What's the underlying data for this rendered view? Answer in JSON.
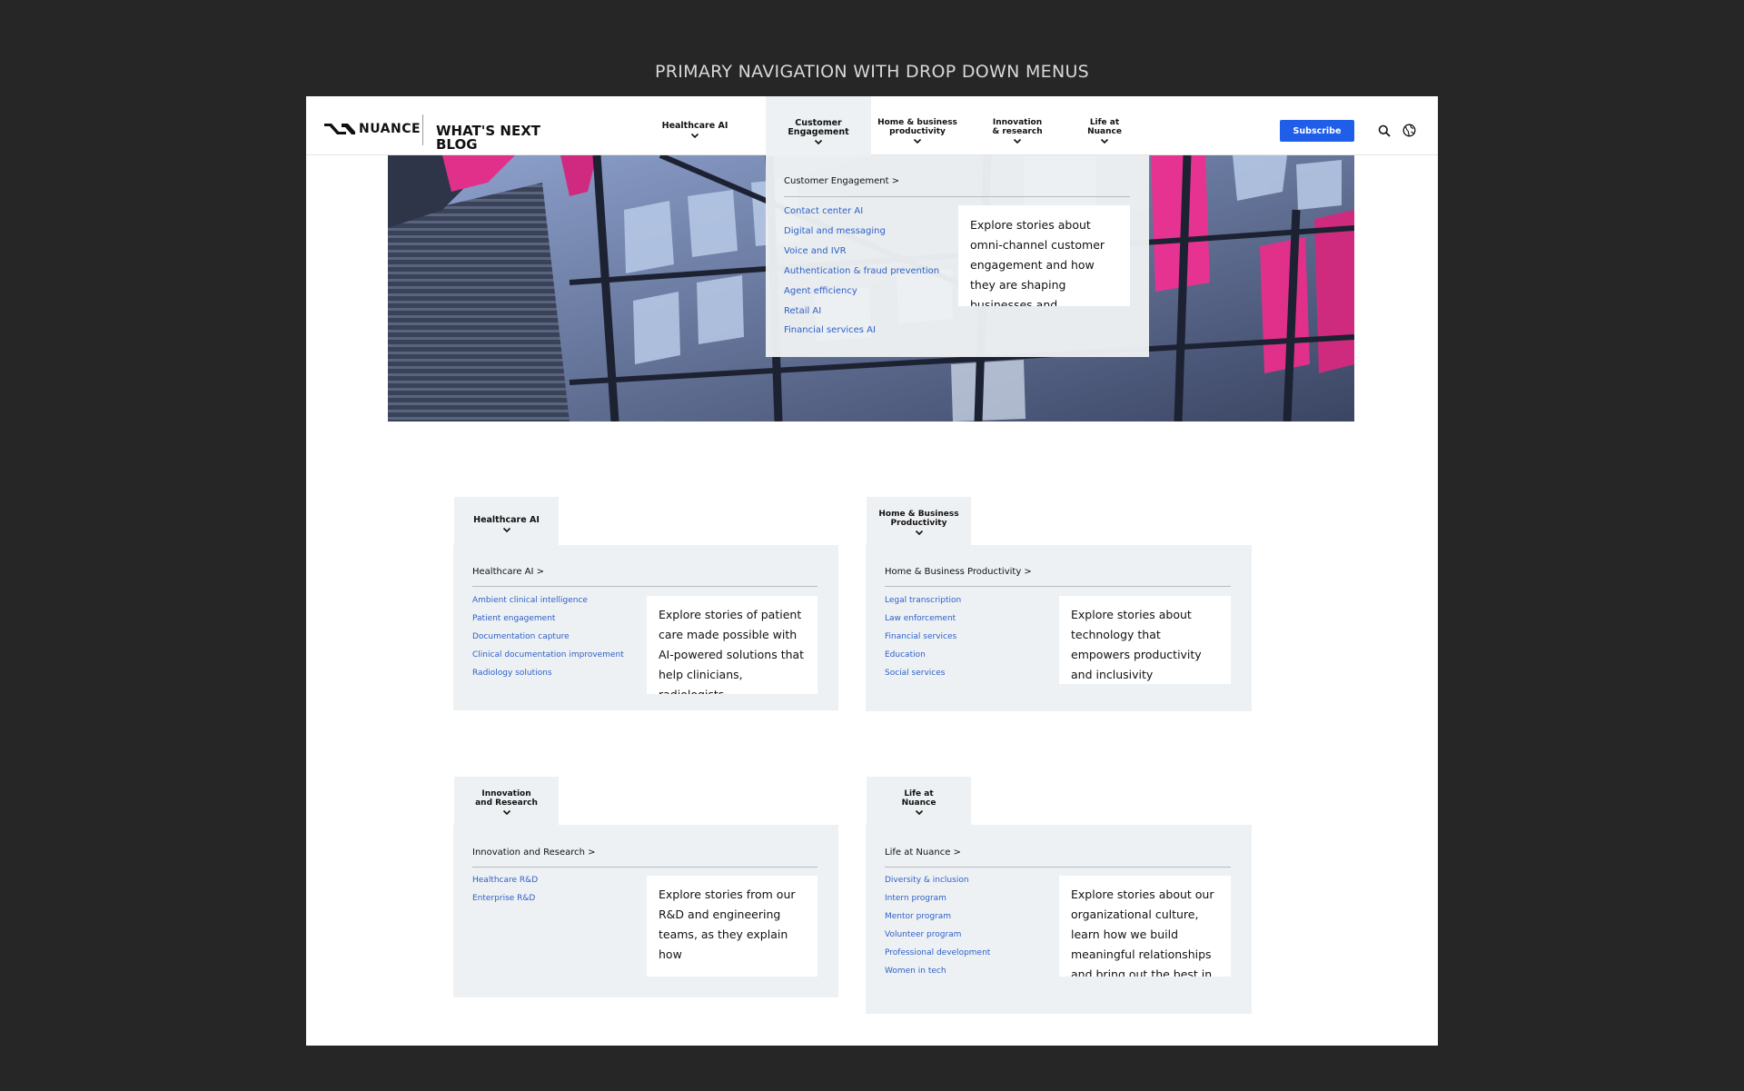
{
  "caption": "PRIMARY NAVIGATION WITH DROP DOWN MENUS",
  "header": {
    "logo_text": "NUANCE",
    "blog_title": "WHAT'S NEXT BLOG",
    "nav": [
      {
        "label": "Healthcare AI"
      },
      {
        "label": "Customer\nEngagement"
      },
      {
        "label": "Home & business\nproductivity"
      },
      {
        "label": "Innovation\n& research"
      },
      {
        "label": "Life at\nNuance"
      }
    ],
    "subscribe_label": "Subscribe",
    "icons": {
      "search": "search-icon",
      "globe": "globe-icon",
      "chevron": "chevron-down-icon"
    }
  },
  "dropdown": {
    "heading": "Customer Engagement >",
    "links": [
      "Contact center AI",
      "Digital and messaging",
      "Voice and IVR",
      "Authentication & fraud prevention",
      "Agent efficiency",
      "Retail AI",
      "Financial services AI"
    ],
    "card_text": "Explore stories about omni-channel customer engagement and how they are shaping businesses and"
  },
  "variants": [
    {
      "tab_label": "Healthcare AI",
      "heading": "Healthcare AI >",
      "links": [
        "Ambient clinical intelligence",
        "Patient engagement",
        "Documentation capture",
        "Clinical documentation improvement",
        "Radiology solutions"
      ],
      "card_text": "Explore stories of patient care made possible with AI-powered solutions that help clinicians, radiologists,"
    },
    {
      "tab_label": "Home & Business\nProductivity",
      "heading": "Home & Business Productivity >",
      "links": [
        "Legal transcription",
        "Law enforcement",
        "Financial services",
        "Education",
        "Social services"
      ],
      "card_text": "Explore stories about technology that empowers productivity and inclusivity"
    },
    {
      "tab_label": "Innovation\nand Research",
      "heading": "Innovation and Research >",
      "links": [
        "Healthcare R&D",
        "Enterprise R&D"
      ],
      "card_text": "Explore stories from our R&D and engineering teams, as they explain how"
    },
    {
      "tab_label": "Life at\nNuance",
      "heading": "Life at Nuance >",
      "links": [
        "Diversity & inclusion",
        "Intern program",
        "Mentor program",
        "Volunteer program",
        "Professional development",
        "Women in tech"
      ],
      "card_text": "Explore stories about our organizational culture, learn how we build meaningful relationships and bring out the best in"
    }
  ],
  "colors": {
    "accent_blue": "#1f5ee8",
    "link_blue": "#2d5fc8",
    "panel_gray": "#eef1f3",
    "page_bg": "#262626",
    "hero_magenta": "#e0308a"
  }
}
